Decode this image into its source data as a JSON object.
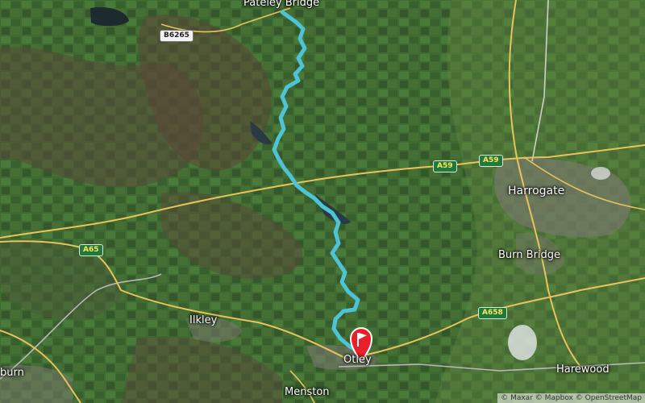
{
  "map": {
    "places": {
      "pateley": "Pateley Bridge",
      "harrogate": "Harrogate",
      "burn_bridge": "Burn Bridge",
      "ilkley": "Ilkley",
      "otley": "Otley",
      "harewood": "Harewood",
      "menston": "Menston",
      "burn_partial": "burn"
    },
    "roads": {
      "b6265": "B6265",
      "a59_west": "A59",
      "a59_east": "A59",
      "a65": "A65",
      "a658": "A658"
    },
    "route": {
      "color": "#4ec3d6",
      "start": "Pateley Bridge",
      "end": "Otley"
    },
    "colors": {
      "road": "#e8c45a",
      "minor_road": "#b9b9b9",
      "end_flag": "#e8202a",
      "start_halo": "#3cc04a"
    },
    "attribution": "© Maxar © Mapbox © OpenStreetMap"
  }
}
